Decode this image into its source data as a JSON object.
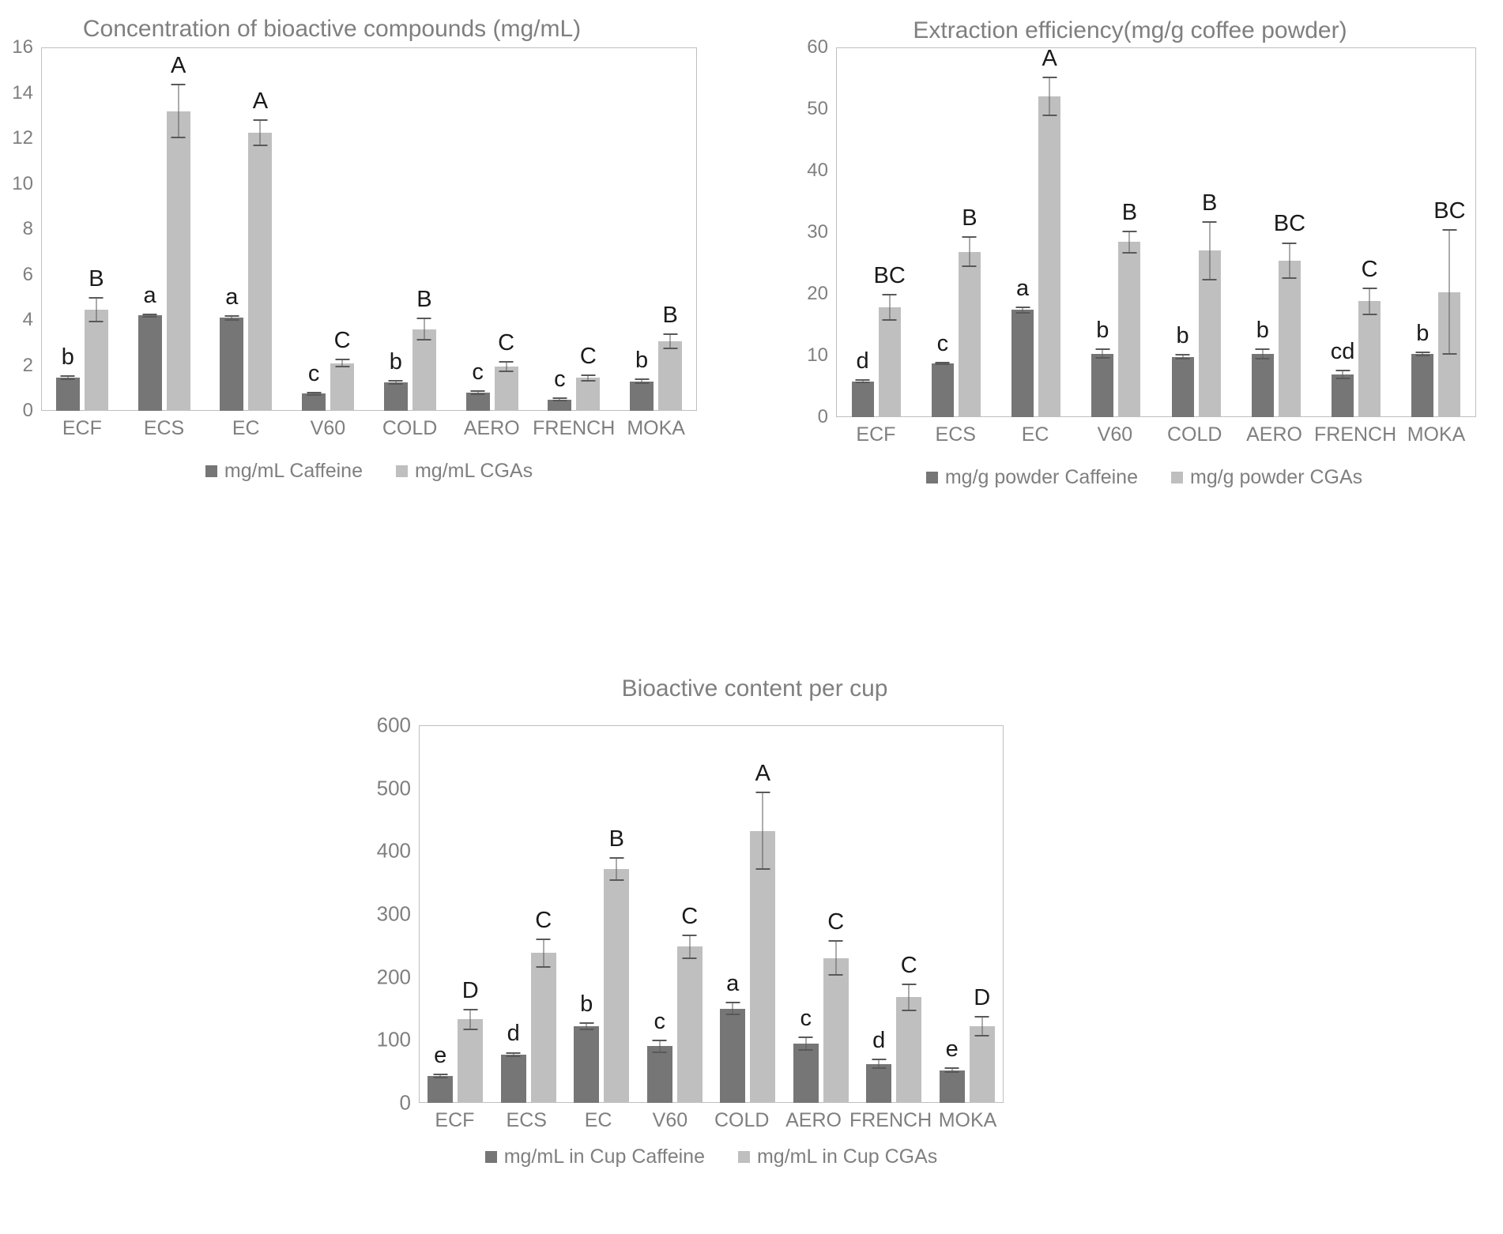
{
  "figure": {
    "background": "#ffffff",
    "series_colors": {
      "caffeine": "#767676",
      "cgas": "#bfbfbf"
    },
    "axis_text_color": "#7f7f7f",
    "sig_label_color": "#1a1a1a"
  },
  "charts": [
    {
      "id": "concentration",
      "title": "Concentration of bioactive compounds (mg/mL)",
      "legend": [
        {
          "label": "mg/mL Caffeine",
          "color": "#767676"
        },
        {
          "label": "mg/mL CGAs",
          "color": "#bfbfbf"
        }
      ],
      "y_ticks": [
        "16",
        "14",
        "12",
        "10",
        "8",
        "6",
        "4",
        "2",
        "0"
      ],
      "x_labels": [
        "ECF",
        "ECS",
        "EC",
        "V60",
        "COLD",
        "AERO",
        "FRENCH",
        "MOKA"
      ]
    },
    {
      "id": "extraction",
      "title": "Extraction efficiency(mg/g coffee powder)",
      "legend": [
        {
          "label": "mg/g powder Caffeine",
          "color": "#767676"
        },
        {
          "label": "mg/g powder CGAs",
          "color": "#bfbfbf"
        }
      ],
      "y_ticks": [
        "60",
        "50",
        "40",
        "30",
        "20",
        "10",
        "0"
      ],
      "x_labels": [
        "ECF",
        "ECS",
        "EC",
        "V60",
        "COLD",
        "AERO",
        "FRENCH",
        "MOKA"
      ]
    },
    {
      "id": "percup",
      "title": "Bioactive content per cup",
      "legend": [
        {
          "label": "mg/mL in Cup Caffeine",
          "color": "#767676"
        },
        {
          "label": "mg/mL in Cup CGAs",
          "color": "#bfbfbf"
        }
      ],
      "y_ticks": [
        "600",
        "500",
        "400",
        "300",
        "200",
        "100",
        "0"
      ],
      "x_labels": [
        "ECF",
        "ECS",
        "EC",
        "V60",
        "COLD",
        "AERO",
        "FRENCH",
        "MOKA"
      ]
    }
  ],
  "chart_data": [
    {
      "type": "bar",
      "title": "Concentration of bioactive compounds (mg/mL)",
      "xlabel": "",
      "ylabel": "",
      "ylim": [
        0,
        16
      ],
      "ytick_step": 2,
      "grid": false,
      "legend_position": "bottom",
      "categories": [
        "ECF",
        "ECS",
        "EC",
        "V60",
        "COLD",
        "AERO",
        "FRENCH",
        "MOKA"
      ],
      "series": [
        {
          "name": "mg/mL Caffeine",
          "color": "#767676",
          "values": [
            1.45,
            4.2,
            4.1,
            0.75,
            1.25,
            0.8,
            0.5,
            1.3
          ],
          "errors": [
            0.1,
            0.08,
            0.12,
            0.1,
            0.1,
            0.1,
            0.08,
            0.12
          ],
          "sig_letters": [
            "b",
            "a",
            "a",
            "c",
            "b",
            "c",
            "c",
            "b"
          ]
        },
        {
          "name": "mg/mL CGAs",
          "color": "#bfbfbf",
          "values": [
            4.45,
            13.2,
            12.25,
            2.1,
            3.6,
            1.95,
            1.45,
            3.05
          ],
          "errors": [
            0.55,
            1.2,
            0.6,
            0.18,
            0.5,
            0.25,
            0.15,
            0.35
          ],
          "sig_letters": [
            "B",
            "A",
            "A",
            "C",
            "B",
            "C",
            "C",
            "B"
          ]
        }
      ]
    },
    {
      "type": "bar",
      "title": "Extraction efficiency(mg/g coffee powder)",
      "xlabel": "",
      "ylabel": "",
      "ylim": [
        0,
        60
      ],
      "ytick_step": 10,
      "grid": false,
      "legend_position": "bottom",
      "categories": [
        "ECF",
        "ECS",
        "EC",
        "V60",
        "COLD",
        "AERO",
        "FRENCH",
        "MOKA"
      ],
      "series": [
        {
          "name": "mg/g powder Caffeine",
          "color": "#767676",
          "values": [
            5.8,
            8.7,
            17.4,
            10.3,
            9.8,
            10.2,
            6.9,
            10.3
          ],
          "errors": [
            0.3,
            0.3,
            0.6,
            0.8,
            0.5,
            0.9,
            0.8,
            0.4
          ],
          "sig_letters": [
            "d",
            "c",
            "a",
            "b",
            "b",
            "b",
            "cd",
            "b"
          ]
        },
        {
          "name": "mg/g powder CGAs",
          "color": "#bfbfbf",
          "values": [
            17.8,
            26.8,
            52.0,
            28.4,
            27.0,
            25.4,
            18.8,
            20.3
          ],
          "errors": [
            2.2,
            2.5,
            3.2,
            1.8,
            4.8,
            3.0,
            2.2,
            10.2
          ],
          "sig_letters": [
            "BC",
            "B",
            "A",
            "B",
            "B",
            "BC",
            "C",
            "BC"
          ]
        }
      ]
    },
    {
      "type": "bar",
      "title": "Bioactive content per cup",
      "xlabel": "",
      "ylabel": "",
      "ylim": [
        0,
        600
      ],
      "ytick_step": 100,
      "grid": false,
      "legend_position": "bottom",
      "categories": [
        "ECF",
        "ECS",
        "EC",
        "V60",
        "COLD",
        "AERO",
        "FRENCH",
        "MOKA"
      ],
      "series": [
        {
          "name": "mg/mL in Cup Caffeine",
          "color": "#767676",
          "values": [
            43,
            77,
            122,
            90,
            150,
            94,
            62,
            52
          ],
          "errors": [
            4,
            4,
            6,
            11,
            11,
            11,
            8,
            4
          ],
          "sig_letters": [
            "e",
            "d",
            "b",
            "c",
            "a",
            "c",
            "d",
            "e"
          ]
        },
        {
          "name": "mg/mL in Cup CGAs",
          "color": "#bfbfbf",
          "values": [
            133,
            238,
            372,
            248,
            432,
            230,
            168,
            122
          ],
          "errors": [
            17,
            23,
            19,
            20,
            62,
            28,
            22,
            16
          ],
          "sig_letters": [
            "D",
            "C",
            "B",
            "C",
            "A",
            "C",
            "C",
            "D"
          ]
        }
      ]
    }
  ]
}
